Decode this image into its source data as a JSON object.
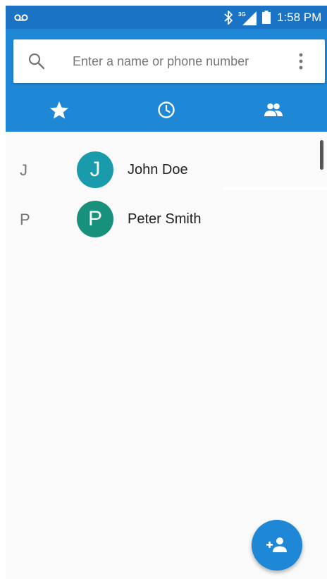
{
  "status_bar": {
    "time": "1:58 PM",
    "network_label": "3G",
    "icons": [
      "voicemail-icon",
      "bluetooth-icon",
      "signal-icon",
      "battery-icon"
    ]
  },
  "search": {
    "placeholder": "Enter a name or phone number",
    "value": ""
  },
  "tabs": [
    {
      "name": "favorites",
      "icon": "star-icon",
      "selected": false
    },
    {
      "name": "recents",
      "icon": "clock-icon",
      "selected": false
    },
    {
      "name": "contacts",
      "icon": "people-icon",
      "selected": true
    }
  ],
  "contacts": [
    {
      "section": "J",
      "initial": "J",
      "name": "John Doe",
      "avatar_color": "#1a9bab"
    },
    {
      "section": "P",
      "initial": "P",
      "name": "Peter Smith",
      "avatar_color": "#17907c"
    }
  ],
  "fab": {
    "icon": "add-contact-icon"
  },
  "colors": {
    "status_bar": "#1a73c4",
    "app_bar": "#1e88d6",
    "background": "#fafafa"
  }
}
